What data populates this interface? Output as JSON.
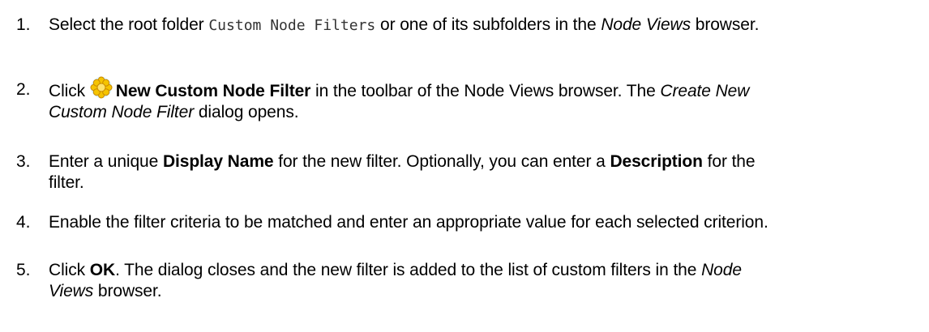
{
  "steps": [
    {
      "number": "1.",
      "t1": "Select the root folder",
      "code": "Custom Node Filters",
      "t2": "or one of its subfolders in the",
      "italic": "Node Views",
      "t3": "browser."
    },
    {
      "number": "2.",
      "t1": "Click",
      "icon": "new-custom-node-filter-icon",
      "bold": "New Custom Node Filter",
      "t2": "in the toolbar of the Node Views browser. The",
      "italic_line1": "Create New",
      "italic_line2": "Custom Node Filter",
      "t3": "dialog opens."
    },
    {
      "number": "3.",
      "t1": "Enter a unique",
      "bold1": "Display Name",
      "t2": "for the new filter. Optionally, you can enter a",
      "bold2": "Description",
      "t3": "for the",
      "t4": "filter."
    },
    {
      "number": "4.",
      "text": "Enable the filter criteria to be matched and enter an appropriate value for each selected criterion."
    },
    {
      "number": "5.",
      "t1": "Click",
      "bold": "OK",
      "t2": ". The dialog closes and the new filter is added to the list of custom filters in the",
      "italic_line1": "Node",
      "italic_line2": "Views",
      "t3": "browser."
    }
  ],
  "colors": {
    "icon_fill": "#f5c400",
    "icon_stroke": "#c98a00",
    "icon_glow": "#8fd3f4"
  }
}
